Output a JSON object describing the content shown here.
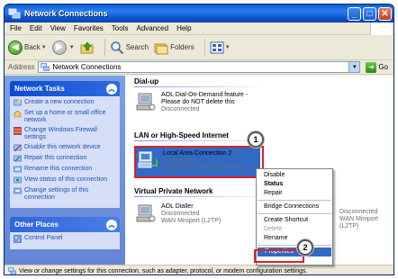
{
  "window": {
    "title": "Network Connections"
  },
  "menubar": {
    "items": [
      "File",
      "Edit",
      "View",
      "Favorites",
      "Tools",
      "Advanced",
      "Help"
    ]
  },
  "toolbar": {
    "back": "Back",
    "search": "Search",
    "folders": "Folders"
  },
  "address": {
    "label": "Address",
    "value": "Network Connections",
    "go": "Go"
  },
  "tasks": {
    "header": "Network Tasks",
    "items": [
      "Create a new connection",
      "Set up a home or small office network",
      "Change Windows Firewall settings",
      "Disable this network device",
      "Repair this connection",
      "Rename this connection",
      "View status of this connection",
      "Change settings of this connection"
    ]
  },
  "other_places": {
    "header": "Other Places",
    "items": [
      "Control Panel"
    ]
  },
  "groups": {
    "dialup": "Dial-up",
    "lan": "LAN or High-Speed Internet",
    "vpn": "Virtual Private Network"
  },
  "connections": {
    "aol_feature": {
      "name": "AOL Dial-On-Demand feature -",
      "line2": "Please do NOT delete this",
      "status": "Disconnected"
    },
    "lan": {
      "name": "Local Area Connection 2",
      "status": "Connected",
      "device": "Realtek RTL8168/8111 PCI-E ..."
    },
    "aol_dialler": {
      "name": "AOL Dialler",
      "status": "Disconnected",
      "device": "WAN Miniport (L2TP)"
    },
    "hidden": {
      "status": "Disconnected",
      "device": "WAN Miniport (L2TP)"
    }
  },
  "context_menu": {
    "items": [
      "Disable",
      "Status",
      "Repair",
      "Bridge Connections",
      "Create Shortcut",
      "Delete",
      "Rename",
      "Properties"
    ]
  },
  "badges": {
    "one": "1",
    "two": "2"
  },
  "statusbar": {
    "text": "View or change settings for this connection, such as adapter, protocol, or modem configuration settings."
  }
}
